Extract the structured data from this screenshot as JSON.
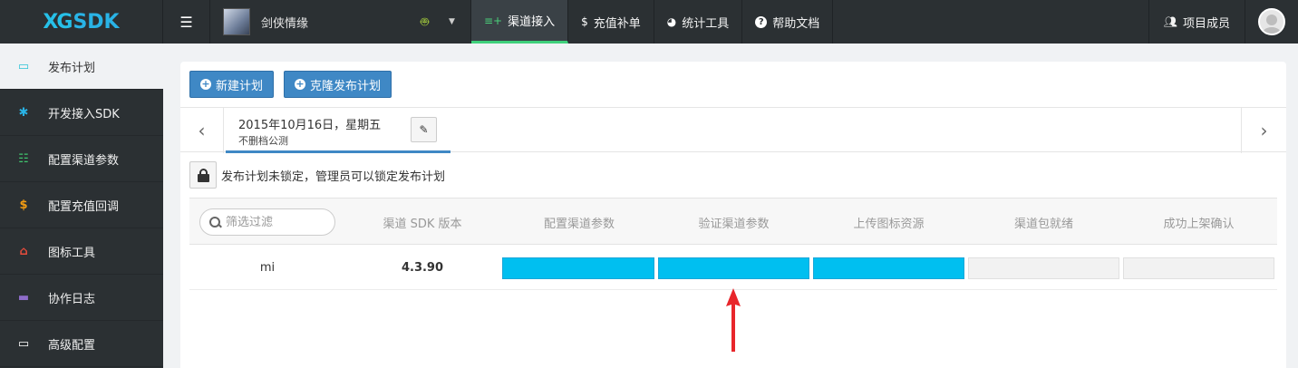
{
  "brand": {
    "logo_mark": "XG",
    "logo_text": "SDK"
  },
  "topbar": {
    "menu_icon": "bars-icon",
    "game_name": "剑侠情缘",
    "platform_icon": "android-icon",
    "nav": [
      {
        "label": "渠道接入",
        "icon": "sitemap-icon",
        "glyph": "≡+",
        "active": true
      },
      {
        "label": "充值补单",
        "icon": "dollar-icon",
        "glyph": "$",
        "active": false
      },
      {
        "label": "统计工具",
        "icon": "pie-chart-icon",
        "glyph": "◕",
        "active": false
      },
      {
        "label": "帮助文档",
        "icon": "question-circle-icon",
        "glyph": "?",
        "active": false
      }
    ],
    "members_label": "项目成员",
    "members_icon": "users-icon"
  },
  "sidebar": {
    "items": [
      {
        "label": "发布计划",
        "icon": "calendar-icon",
        "glyph": "▭",
        "color": "#2ec4d6",
        "active": true
      },
      {
        "label": "开发接入SDK",
        "icon": "gear-icon",
        "glyph": "✱",
        "color": "#29b3e6",
        "active": false
      },
      {
        "label": "配置渠道参数",
        "icon": "list-icon",
        "glyph": "☷",
        "color": "#3fc46e",
        "active": false
      },
      {
        "label": "配置充值回调",
        "icon": "dollar-icon",
        "glyph": "$",
        "color": "#f39c12",
        "active": false
      },
      {
        "label": "图标工具",
        "icon": "image-icon",
        "glyph": "⌂",
        "color": "#e74c3c",
        "active": false
      },
      {
        "label": "协作日志",
        "icon": "comment-icon",
        "glyph": "▬",
        "color": "#8e6cc9",
        "active": false
      },
      {
        "label": "高级配置",
        "icon": "laptop-icon",
        "glyph": "▭",
        "color": "#ffffff",
        "active": false
      }
    ]
  },
  "toolbar": {
    "new_plan": "新建计划",
    "clone_plan": "克隆发布计划"
  },
  "date_tab": {
    "date": "2015年10月16日，星期五",
    "subtitle": "不删档公测",
    "edit_icon": "pencil-icon"
  },
  "lock_notice": {
    "icon": "lock-icon",
    "text": "发布计划未锁定，管理员可以锁定发布计划"
  },
  "table": {
    "filter_placeholder": "筛选过滤",
    "headers": [
      "渠道 SDK 版本",
      "配置渠道参数",
      "验证渠道参数",
      "上传图标资源",
      "渠道包就绪",
      "成功上架确认"
    ],
    "rows": [
      {
        "channel": "mi",
        "sdk_version": "4.3.90",
        "stages": [
          true,
          true,
          true,
          false,
          false
        ]
      }
    ]
  },
  "annotation": {
    "arrow_color": "#e8262b"
  }
}
